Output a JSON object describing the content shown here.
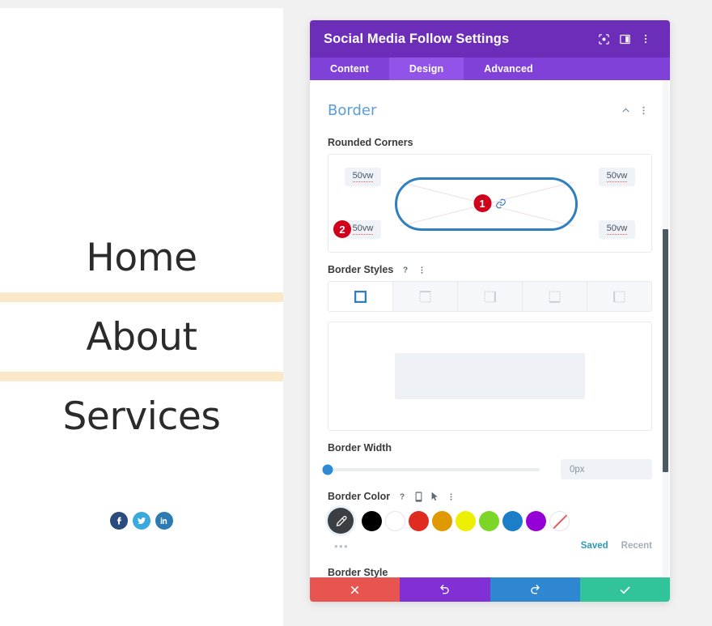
{
  "website_preview": {
    "menu_items": [
      {
        "label": "Home"
      },
      {
        "label": "About"
      },
      {
        "label": "Services"
      }
    ],
    "social_icons": [
      {
        "name": "facebook-icon",
        "color": "#2b4a7d"
      },
      {
        "name": "twitter-icon",
        "color": "#3ba9dd"
      },
      {
        "name": "linkedin-icon",
        "color": "#2e7bb4"
      }
    ],
    "divider_color": "#fae8c8"
  },
  "modal": {
    "title": "Social Media Follow Settings",
    "header_icons": [
      {
        "name": "viewport-focus-icon"
      },
      {
        "name": "split-layout-icon"
      },
      {
        "name": "more-vertical-icon"
      }
    ],
    "tabs": [
      {
        "label": "Content",
        "active": false
      },
      {
        "label": "Design",
        "active": true
      },
      {
        "label": "Advanced",
        "active": false
      }
    ],
    "section": {
      "title": "Border",
      "collapse_icon": "chevron-up-icon",
      "menu_icon": "more-vertical-icon"
    },
    "rounded_corners": {
      "label": "Rounded Corners",
      "top_left": "50vw",
      "top_right": "50vw",
      "bottom_left": "50vw",
      "bottom_right": "50vw",
      "shape_color": "#2f7fbe",
      "link_icon": "chain-link-icon",
      "badge_center": "1",
      "badge_bottom_left": "2",
      "badge_color": "#d0021b"
    },
    "border_styles": {
      "label": "Border Styles",
      "help_icon": "question-mark-icon",
      "menu_icon": "more-vertical-icon",
      "options": [
        {
          "name": "border-all-sides",
          "active": true
        },
        {
          "name": "border-top",
          "active": false
        },
        {
          "name": "border-right",
          "active": false
        },
        {
          "name": "border-bottom",
          "active": false
        },
        {
          "name": "border-left",
          "active": false
        }
      ]
    },
    "border_width": {
      "label": "Border Width",
      "value": "0px",
      "slider_percent": 0,
      "slider_color": "#2d8bd4"
    },
    "border_color": {
      "label": "Border Color",
      "help_icon": "question-mark-icon",
      "device_icon": "mobile-icon",
      "hover_icon": "cursor-icon",
      "menu_icon": "more-vertical-icon",
      "picker_icon": "eyedropper-icon",
      "swatches": [
        {
          "name": "swatch-black",
          "color": "#000000"
        },
        {
          "name": "swatch-white",
          "color": "#ffffff"
        },
        {
          "name": "swatch-red",
          "color": "#e02b20"
        },
        {
          "name": "swatch-orange",
          "color": "#e09900"
        },
        {
          "name": "swatch-yellow",
          "color": "#edef00"
        },
        {
          "name": "swatch-green",
          "color": "#7cd628"
        },
        {
          "name": "swatch-blue",
          "color": "#1c7ec7"
        },
        {
          "name": "swatch-purple",
          "color": "#9500d6"
        }
      ],
      "none_swatch": "swatch-none",
      "more_dots": "•••",
      "saved_label": "Saved",
      "recent_label": "Recent"
    },
    "border_style": {
      "label": "Border Style"
    },
    "footer": {
      "cancel": {
        "name": "cancel-button",
        "icon": "close-icon",
        "color": "#e8544f"
      },
      "undo": {
        "name": "undo-button",
        "icon": "undo-icon",
        "color": "#8030d4"
      },
      "redo": {
        "name": "redo-button",
        "icon": "redo-icon",
        "color": "#2f86d1"
      },
      "save": {
        "name": "save-button",
        "icon": "checkmark-icon",
        "color": "#31c49a"
      }
    }
  }
}
